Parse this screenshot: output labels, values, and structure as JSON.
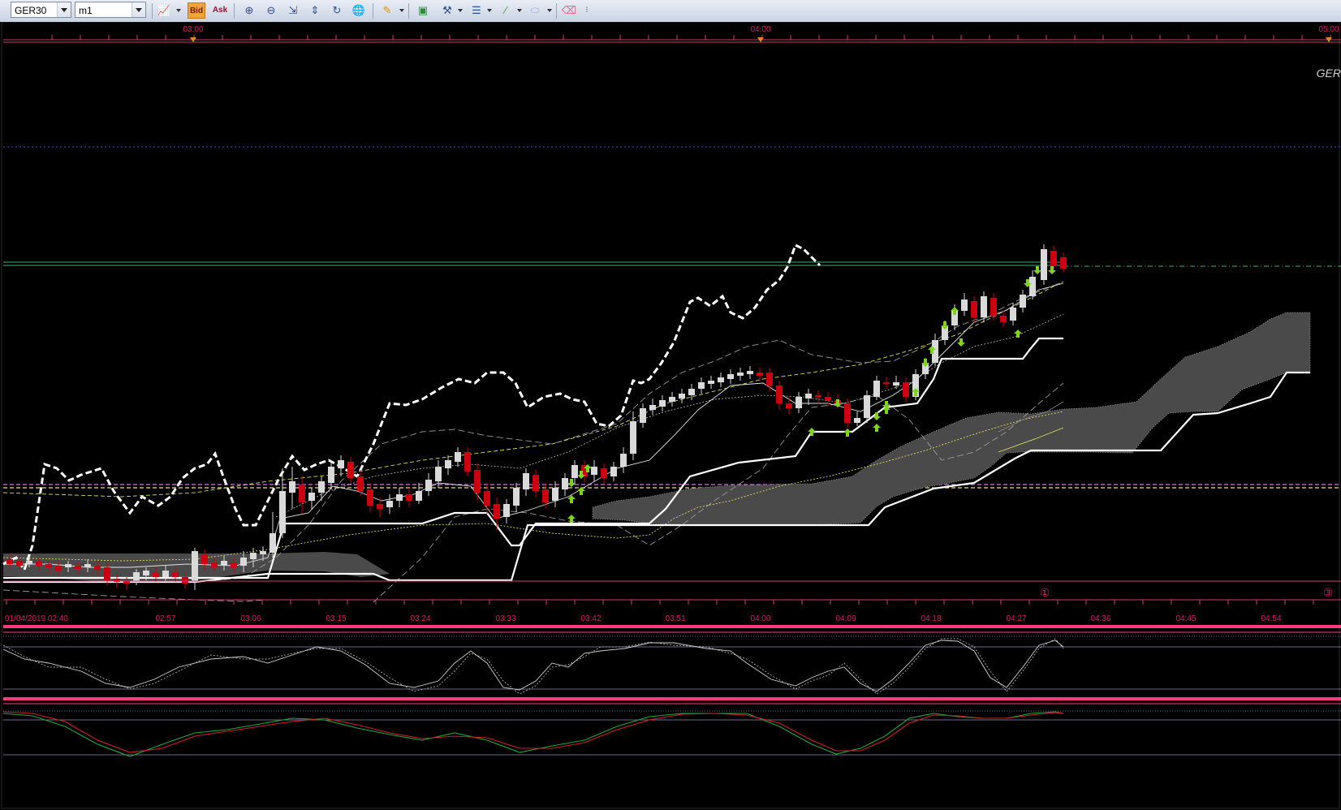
{
  "toolbar": {
    "symbol": "GER30",
    "timeframe": "m1",
    "bid_label": "Bid",
    "ask_label": "Ask",
    "icons": [
      "indicator-icon",
      "bid-toggle",
      "ask-toggle",
      "zoom-in-icon",
      "zoom-out-icon",
      "fit-icon",
      "scale-icon",
      "refresh-icon",
      "globe-icon",
      "draw-pencil-icon",
      "image-icon",
      "tools-icon",
      "lines-icon",
      "line-color-icon",
      "shape-icon",
      "eraser-icon",
      "more-icon"
    ]
  },
  "chart": {
    "watermark": "GER",
    "top_axis_labels": [
      "03:00",
      "04:00",
      "05:00"
    ],
    "bottom_axis_labels": [
      "01/04/2019 02:40",
      "02:57",
      "03:06",
      "03:15",
      "03:24",
      "03:33",
      "03:42",
      "03:51",
      "04:00",
      "04:09",
      "04:18",
      "04:27",
      "04:36",
      "04:45",
      "04:54"
    ],
    "event_markers": [
      "①",
      "③"
    ],
    "colors": {
      "background": "#000000",
      "axis_text": "#d11f6b",
      "bull_candle": "#d9d9d9",
      "bear_candle": "#cc0011",
      "kumo": "#4a4a4a",
      "separator": "#ff3b7f",
      "arrow": "#7ed321"
    }
  }
}
